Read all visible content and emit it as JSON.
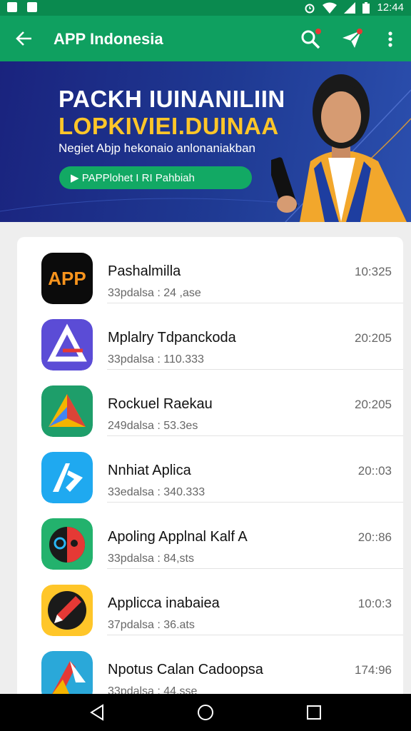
{
  "status": {
    "time": "12:44"
  },
  "header": {
    "title": "APP Indonesia"
  },
  "banner": {
    "line1": "PACKH IUINANILIIN",
    "line2": "LOPKIVIEI.DUINAA",
    "subtitle": "Negiet Abjp hekonaio anlonaniakban",
    "cta_label": "▶ PAPPlohet I RI Pahbiah"
  },
  "apps": [
    {
      "name": "Pashalmilla",
      "meta": "33pdalsa : 24 ,ase",
      "time": "10:325",
      "icon": "app-orange-icon"
    },
    {
      "name": "Mplalry Tdpanckoda",
      "meta": "33pdalsa : 110.333",
      "time": "20:205",
      "icon": "purple-triangle-icon"
    },
    {
      "name": "Rockuel Raekau",
      "meta": "249dalsa : 53.3es",
      "time": "20:205",
      "icon": "colorful-arrow-icon"
    },
    {
      "name": "Nnhiat Aplica",
      "meta": "33edalsa : 340.333",
      "time": "20::03",
      "icon": "blue-a-icon"
    },
    {
      "name": "Apoling Applnal Kalf A",
      "meta": "33pdalsa : 84,sts",
      "time": "20::86",
      "icon": "robot-face-icon"
    },
    {
      "name": "Applicca inabaiea",
      "meta": "37pdalsa : 36.ats",
      "time": "10:0:3",
      "icon": "pen-icon"
    },
    {
      "name": "Npotus Calan Cadoopsa",
      "meta": "33pdalsa : 44,sse",
      "time": "174:96",
      "icon": "red-arrow-icon"
    }
  ],
  "icon_badge_text": "APP",
  "colors": {
    "appbar": "#0fa060",
    "statusbar": "#0a8a4f",
    "accent_yellow": "#ffc629"
  }
}
